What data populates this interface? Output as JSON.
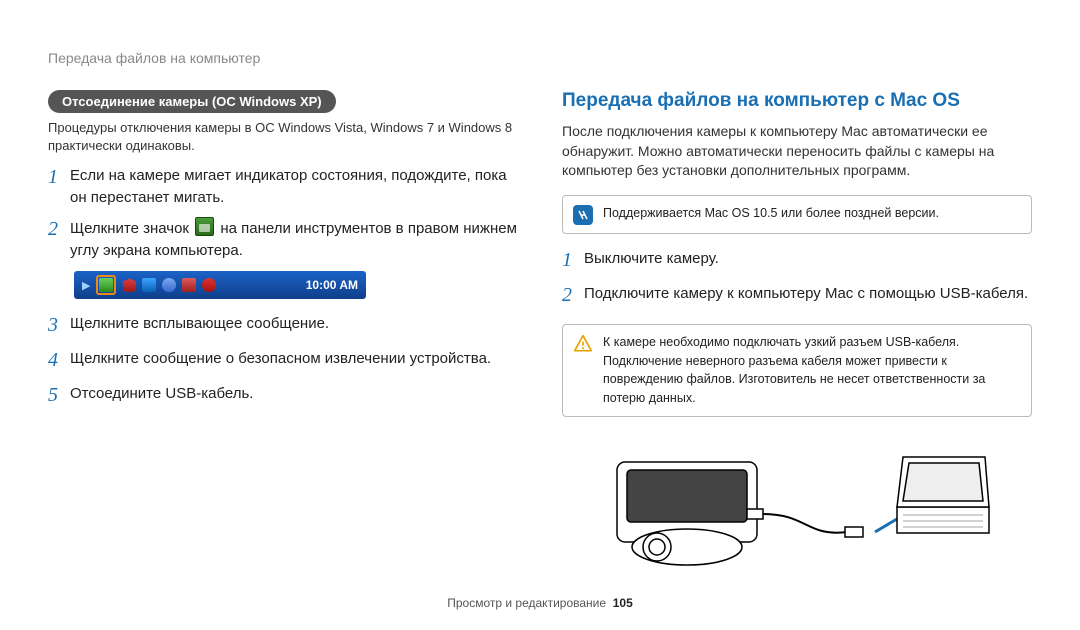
{
  "breadcrumb": "Передача файлов на компьютер",
  "left": {
    "pill": "Отсоединение камеры (ОС Windows XP)",
    "sub": "Процедуры отключения камеры в ОС Windows Vista, Windows 7 и Windows 8 практически одинаковы.",
    "step1": "Если на камере мигает индикатор состояния, подождите, пока он перестанет мигать.",
    "step2a": "Щелкните значок ",
    "step2b": " на панели инструментов в правом нижнем углу экрана компьютера.",
    "tray_time": "10:00 AM",
    "step3": "Щелкните всплывающее сообщение.",
    "step4": "Щелкните сообщение о безопасном извлечении устройства.",
    "step5": "Отсоедините USB-кабель."
  },
  "right": {
    "heading": "Передача файлов на компьютер с Mac OS",
    "intro": "После подключения камеры к компьютеру Mac автоматически ее обнаружит. Можно автоматически переносить файлы с камеры на компьютер без установки дополнительных программ.",
    "info_note": "Поддерживается Mac OS 10.5 или более поздней версии.",
    "step1": "Выключите камеру.",
    "step2": "Подключите камеру к компьютеру Mac с помощью USB-кабеля.",
    "warn_note": "К камере необходимо подключать узкий разъем USB-кабеля. Подключение неверного разъема кабеля может привести к повреждению файлов. Изготовитель не несет ответственности за потерю данных."
  },
  "footer": {
    "section": "Просмотр и редактирование",
    "page": "105"
  }
}
